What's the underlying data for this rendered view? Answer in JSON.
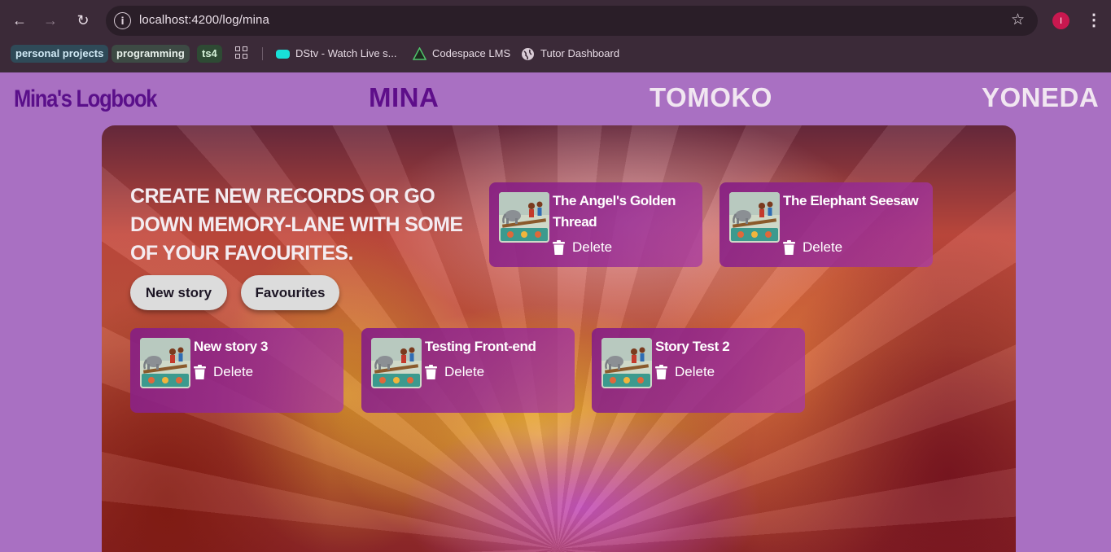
{
  "browser": {
    "url": "localhost:4200/log/mina",
    "profile_initial": "I",
    "bookmarks": {
      "groups": [
        "personal projects",
        "programming",
        "ts4"
      ],
      "links": [
        "DStv - Watch Live s...",
        "Codespace LMS",
        "Tutor Dashboard"
      ]
    }
  },
  "site": {
    "logo": "Mina's Logbook",
    "nav": [
      "MINA",
      "TOMOKO",
      "YONEDA"
    ]
  },
  "hero": {
    "headline": "CREATE NEW RECORDS OR GO DOWN MEMORY-LANE WITH SOME OF YOUR FAVOURITES.",
    "buttons": {
      "new_story": "New story",
      "favourites": "Favourites"
    }
  },
  "stories": [
    {
      "title": "The Angel's Golden Thread",
      "delete_label": "Delete"
    },
    {
      "title": "The Elephant Seesaw",
      "delete_label": "Delete"
    },
    {
      "title": "New story 3",
      "delete_label": "Delete"
    },
    {
      "title": "Testing Front-end",
      "delete_label": "Delete"
    },
    {
      "title": "Story Test 2",
      "delete_label": "Delete"
    }
  ],
  "colors": {
    "page_bg": "#a970c2",
    "logo": "#5a0f8a",
    "active_nav": "#5e0e8a",
    "card": "#8a2a86"
  }
}
